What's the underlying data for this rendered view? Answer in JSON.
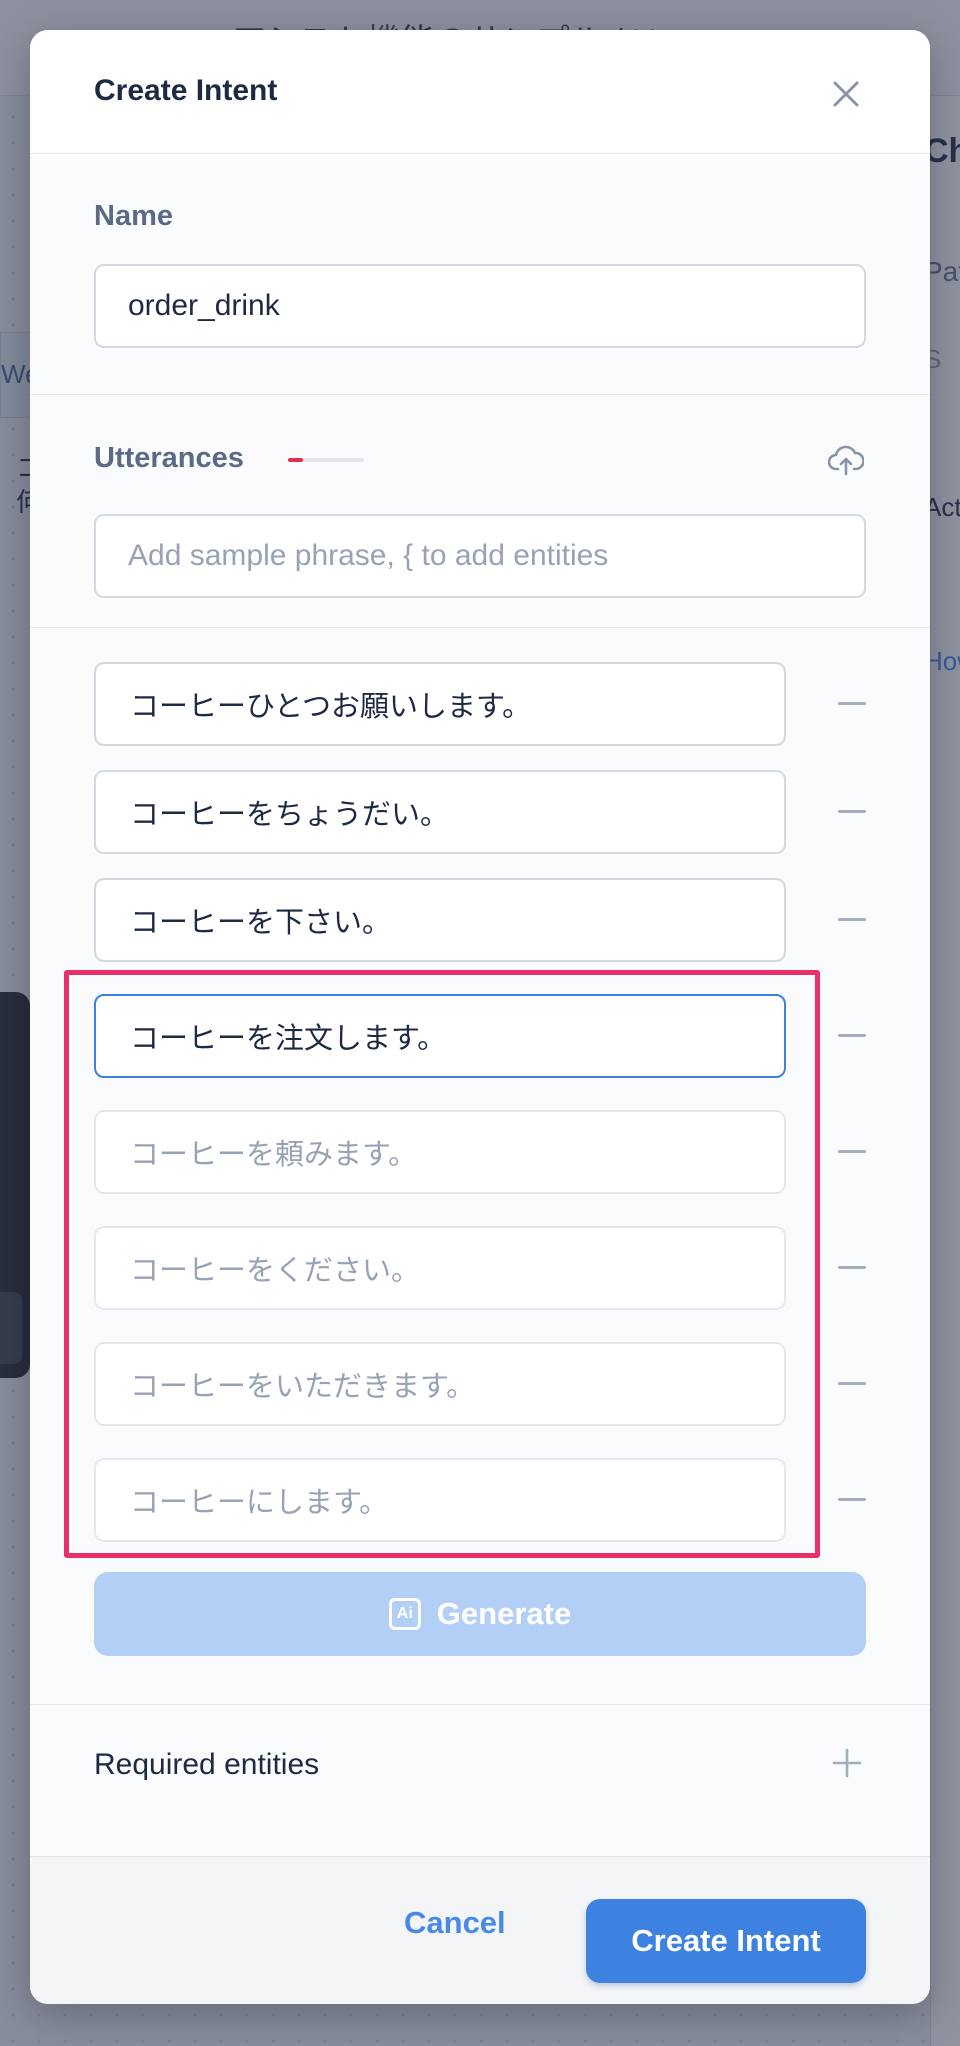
{
  "background": {
    "breadcrumb": "アシスト機能のサンプル / U...",
    "right_fragments": [
      "Ch",
      "Pat",
      "S",
      "Act",
      "How"
    ],
    "left_tab": "We",
    "left_fragments": [
      "コ",
      "何"
    ]
  },
  "modal": {
    "title": "Create Intent",
    "close_icon": "close-icon"
  },
  "name_section": {
    "label": "Name",
    "value": "order_drink"
  },
  "utterances_section": {
    "label": "Utterances",
    "progress_fraction": 0.2,
    "progress_color": "#e0344e",
    "upload_icon": "cloud-upload-icon",
    "new_placeholder": "Add sample phrase, { to add entities",
    "items": [
      {
        "value": "コーヒーひとつお願いします。"
      },
      {
        "value": "コーヒーをちょうだい。"
      },
      {
        "value": "コーヒーを下さい。"
      },
      {
        "value": "コーヒーを注文します。"
      },
      {
        "value": "コーヒーを頼みます。"
      },
      {
        "value": "コーヒーをください。"
      },
      {
        "value": "コーヒーをいただきます。"
      },
      {
        "value": "コーヒーにします。"
      }
    ]
  },
  "generate_button": {
    "label": "Generate",
    "icon_text": "Ai"
  },
  "required_entities": {
    "label": "Required entities"
  },
  "footer": {
    "cancel_label": "Cancel",
    "create_label": "Create Intent"
  },
  "colors": {
    "accent": "#3d82e0",
    "highlight": "#ea2f6b"
  }
}
